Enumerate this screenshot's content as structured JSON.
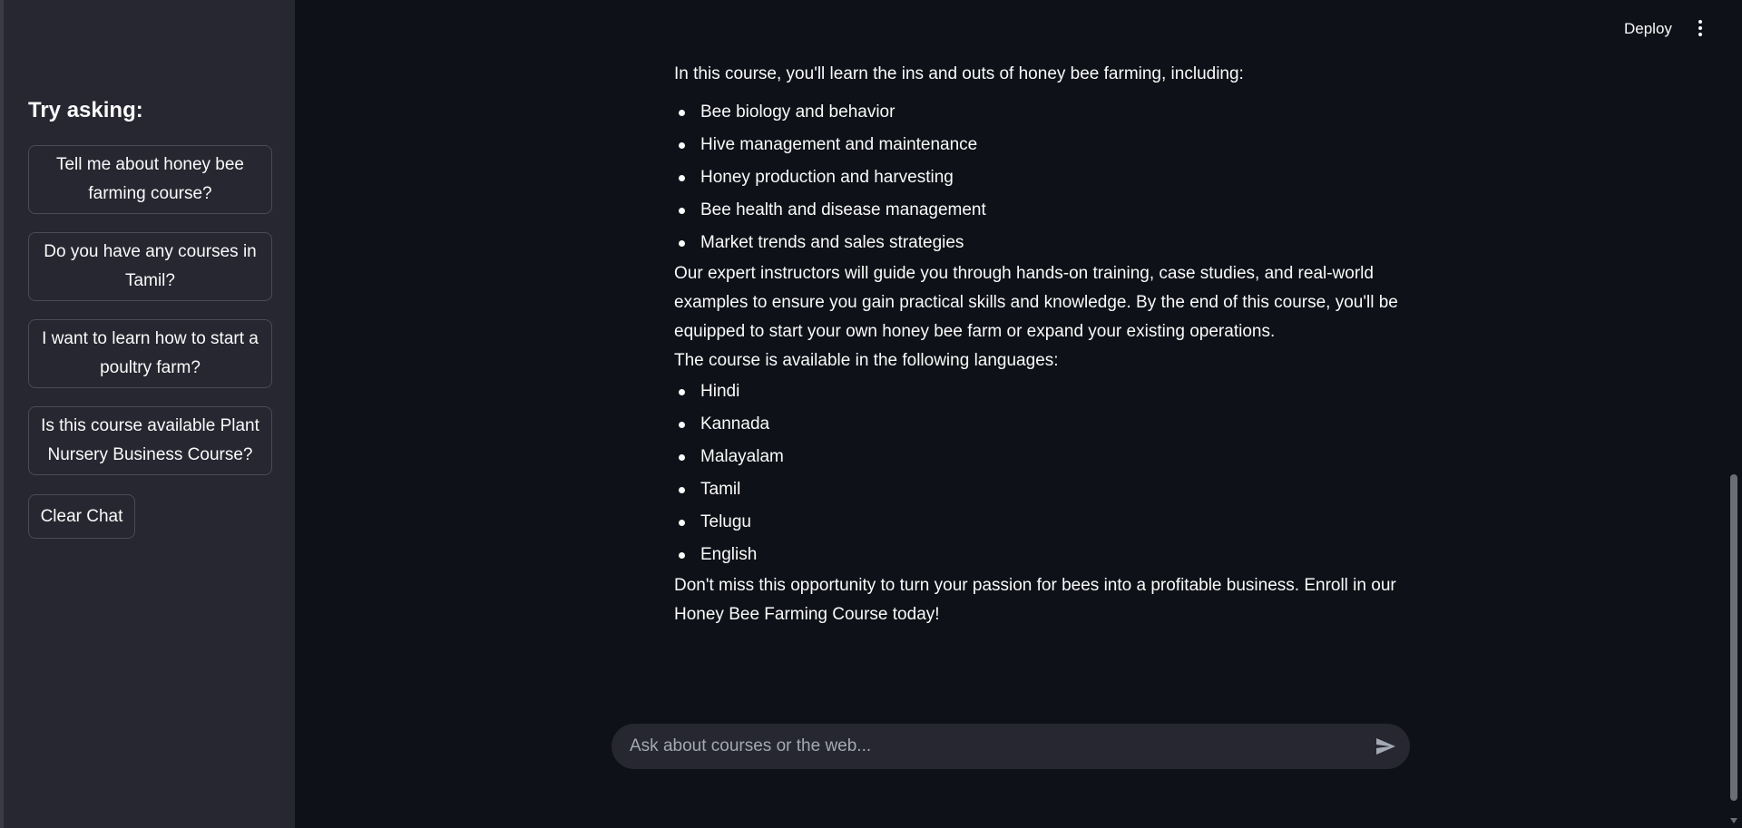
{
  "header": {
    "deploy_label": "Deploy",
    "menu_icon": "vertical-dots-icon"
  },
  "sidebar": {
    "title": "Try asking:",
    "suggestions": [
      "Tell me about honey bee farming course?",
      "Do you have any courses in Tamil?",
      "I want to learn how to start a poultry farm?",
      "Is this course available Plant Nursery Business Course?"
    ],
    "clear_label": "Clear Chat"
  },
  "message": {
    "intro": "In this course, you'll learn the ins and outs of honey bee farming, including:",
    "topics": [
      "Bee biology and behavior",
      "Hive management and maintenance",
      "Honey production and harvesting",
      "Bee health and disease management",
      "Market trends and sales strategies"
    ],
    "instructors": "Our expert instructors will guide you through hands-on training, case studies, and real-world examples to ensure you gain practical skills and knowledge. By the end of this course, you'll be equipped to start your own honey bee farm or expand your existing operations.",
    "languages_intro": "The course is available in the following languages:",
    "languages": [
      "Hindi",
      "Kannada",
      "Malayalam",
      "Tamil",
      "Telugu",
      "English"
    ],
    "closing": "Don't miss this opportunity to turn your passion for bees into a profitable business. Enroll in our Honey Bee Farming Course today!"
  },
  "chat_input": {
    "placeholder": "Ask about courses or the web...",
    "value": "",
    "send_icon": "send-icon"
  },
  "colors": {
    "background": "#0e1117",
    "sidebar": "#262730",
    "text": "#fafafa",
    "input_bg": "#262730"
  }
}
